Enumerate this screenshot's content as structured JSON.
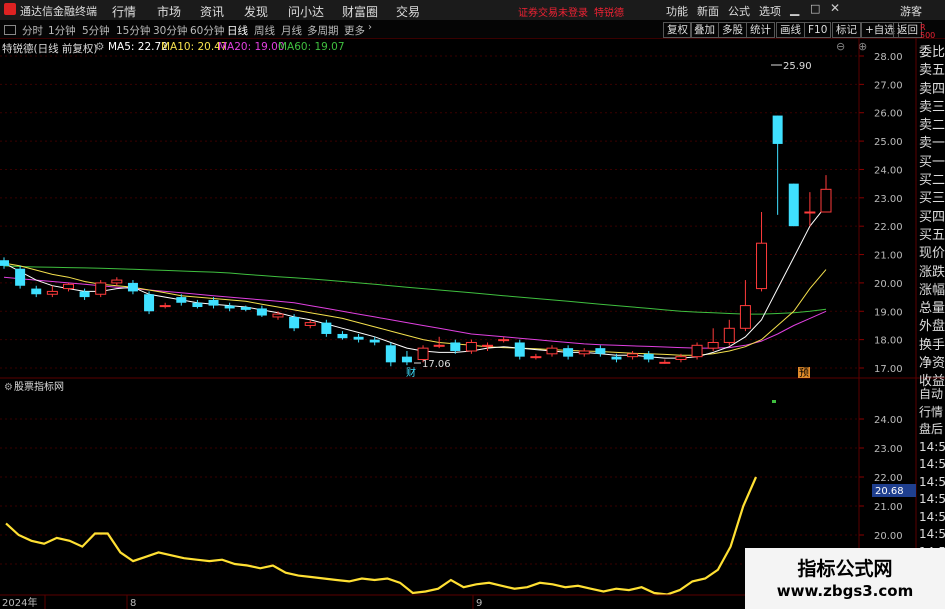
{
  "app": {
    "title": "通达信金融终端",
    "menu": [
      "行情",
      "市场",
      "资讯",
      "发现",
      "问小达",
      "财富圈",
      "交易"
    ],
    "login_warning": "证券交易未登录",
    "stock_tag": "特锐德",
    "right_menu": [
      "功能",
      "新面",
      "公式",
      "选项"
    ],
    "guest": "游客"
  },
  "periods": [
    "分时",
    "1分钟",
    "5分钟",
    "15分钟",
    "30分钟",
    "60分钟",
    "日线",
    "周线",
    "月线",
    "多周期",
    "更多"
  ],
  "active_period": "日线",
  "tools": [
    "复权",
    "叠加",
    "多股",
    "统计",
    "画线",
    "F10",
    "标记",
    "+自选",
    "返回"
  ],
  "chart_header": {
    "stock_name": "特锐德(日线 前复权)",
    "ma": [
      {
        "label": "MA5: 22.72",
        "color": "#ffffff"
      },
      {
        "label": "MA10: 20.47",
        "color": "#f4e04d"
      },
      {
        "label": "MA20: 19.00",
        "color": "#e040e0"
      },
      {
        "label": "MA60: 19.07",
        "color": "#3fbf3f"
      }
    ]
  },
  "indicator_title": "股票指标网",
  "price_axis": [
    "28.00",
    "27.00",
    "26.00",
    "25.00",
    "24.00",
    "23.00",
    "22.00",
    "21.00",
    "20.00",
    "19.00",
    "18.00",
    "17.00"
  ],
  "indicator_axis": [
    "24.00",
    "23.00",
    "22.00",
    "21.00",
    "20.00",
    "19.00"
  ],
  "indicator_value_box": "20.68",
  "annotations": {
    "high": "25.90",
    "low": "17.06",
    "cai": "财",
    "yu": "预"
  },
  "right_labels": [
    "委比",
    "卖五",
    "卖四",
    "卖三",
    "卖二",
    "卖一",
    "买一",
    "买二",
    "买三",
    "买四",
    "买五",
    "现价",
    "涨跌",
    "涨幅",
    "总量",
    "外盘",
    "换手",
    "净资",
    "收益"
  ],
  "right_labels_lower": [
    "自动",
    "行情",
    "盘后",
    "14:50",
    "14:50",
    "14:50",
    "14:50",
    "14:50",
    "14:50",
    "14:50",
    "14:50",
    "14:50"
  ],
  "right_top_small": [
    "R",
    "500"
  ],
  "time_axis": [
    "2024年",
    "8",
    "9"
  ],
  "watermark": {
    "line1": "指标公式网",
    "line2": "www.zbgs3.com"
  },
  "colors": {
    "up": "#ff3b3b",
    "down": "#3fe0ff",
    "indicator": "#ffe033"
  },
  "chart_data": {
    "type": "candlestick",
    "ylim": [
      17.0,
      28.0
    ],
    "candles": [
      [
        20.8,
        20.6,
        20.9,
        20.5
      ],
      [
        20.5,
        19.9,
        20.6,
        19.8
      ],
      [
        19.8,
        19.6,
        19.9,
        19.5
      ],
      [
        19.6,
        19.7,
        19.9,
        19.5
      ],
      [
        19.8,
        19.95,
        20.0,
        19.7
      ],
      [
        19.7,
        19.5,
        19.8,
        19.4
      ],
      [
        19.6,
        20.0,
        20.1,
        19.5
      ],
      [
        20.0,
        20.1,
        20.2,
        19.9
      ],
      [
        20.0,
        19.7,
        20.1,
        19.6
      ],
      [
        19.6,
        19.0,
        19.7,
        18.9
      ],
      [
        19.2,
        19.2,
        19.3,
        19.1
      ],
      [
        19.5,
        19.3,
        19.6,
        19.2
      ],
      [
        19.3,
        19.15,
        19.4,
        19.1
      ],
      [
        19.4,
        19.2,
        19.5,
        19.1
      ],
      [
        19.2,
        19.1,
        19.3,
        19.0
      ],
      [
        19.15,
        19.05,
        19.2,
        19.0
      ],
      [
        19.1,
        18.85,
        19.2,
        18.8
      ],
      [
        18.8,
        18.9,
        19.0,
        18.7
      ],
      [
        18.8,
        18.4,
        18.9,
        18.3
      ],
      [
        18.5,
        18.6,
        18.7,
        18.4
      ],
      [
        18.6,
        18.2,
        18.7,
        18.1
      ],
      [
        18.2,
        18.05,
        18.3,
        18.0
      ],
      [
        18.1,
        18.0,
        18.2,
        17.9
      ],
      [
        18.0,
        17.9,
        18.1,
        17.8
      ],
      [
        17.8,
        17.2,
        17.9,
        17.06
      ],
      [
        17.4,
        17.2,
        17.6,
        17.1
      ],
      [
        17.3,
        17.7,
        17.8,
        17.2
      ],
      [
        17.8,
        17.8,
        18.1,
        17.7
      ],
      [
        17.9,
        17.6,
        18.0,
        17.5
      ],
      [
        17.6,
        17.9,
        18.0,
        17.5
      ],
      [
        17.8,
        17.8,
        17.9,
        17.6
      ],
      [
        18.0,
        18.0,
        18.1,
        17.9
      ],
      [
        17.9,
        17.4,
        18.0,
        17.3
      ],
      [
        17.4,
        17.4,
        17.5,
        17.3
      ],
      [
        17.5,
        17.7,
        17.8,
        17.4
      ],
      [
        17.7,
        17.4,
        17.8,
        17.3
      ],
      [
        17.5,
        17.6,
        17.7,
        17.4
      ],
      [
        17.7,
        17.5,
        17.8,
        17.4
      ],
      [
        17.4,
        17.3,
        17.5,
        17.2
      ],
      [
        17.4,
        17.5,
        17.6,
        17.3
      ],
      [
        17.5,
        17.3,
        17.6,
        17.2
      ],
      [
        17.2,
        17.2,
        17.3,
        17.15
      ],
      [
        17.3,
        17.4,
        17.5,
        17.2
      ],
      [
        17.4,
        17.8,
        17.9,
        17.3
      ],
      [
        17.7,
        17.9,
        18.4,
        17.6
      ],
      [
        17.9,
        18.4,
        18.7,
        17.8
      ],
      [
        18.4,
        19.2,
        20.1,
        18.3
      ],
      [
        19.8,
        21.4,
        22.5,
        19.7
      ],
      [
        25.9,
        24.9,
        25.9,
        22.4
      ],
      [
        23.5,
        22.0,
        23.5,
        22.0
      ],
      [
        22.5,
        22.5,
        23.2,
        22.0
      ],
      [
        22.5,
        23.3,
        23.8,
        22.5
      ]
    ],
    "ma5": [
      20.7,
      20.4,
      20.1,
      19.9,
      19.8,
      19.7,
      19.7,
      19.8,
      19.85,
      19.6,
      19.5,
      19.4,
      19.3,
      19.25,
      19.2,
      19.15,
      19.05,
      18.95,
      18.8,
      18.7,
      18.55,
      18.4,
      18.25,
      18.1,
      17.9,
      17.7,
      17.6,
      17.55,
      17.55,
      17.6,
      17.7,
      17.75,
      17.7,
      17.65,
      17.6,
      17.55,
      17.55,
      17.5,
      17.45,
      17.45,
      17.4,
      17.35,
      17.35,
      17.4,
      17.55,
      17.75,
      18.1,
      18.7,
      19.8,
      20.9,
      22.0,
      22.72
    ],
    "ma10": [
      20.7,
      20.6,
      20.45,
      20.3,
      20.2,
      20.05,
      19.95,
      19.9,
      19.85,
      19.75,
      19.65,
      19.55,
      19.5,
      19.45,
      19.4,
      19.35,
      19.25,
      19.15,
      19.05,
      18.95,
      18.85,
      18.75,
      18.6,
      18.45,
      18.3,
      18.15,
      18.0,
      17.9,
      17.85,
      17.8,
      17.75,
      17.72,
      17.7,
      17.68,
      17.65,
      17.62,
      17.6,
      17.58,
      17.55,
      17.52,
      17.5,
      17.48,
      17.45,
      17.45,
      17.5,
      17.6,
      17.75,
      18.0,
      18.5,
      19.0,
      19.8,
      20.47
    ],
    "ma20": [
      20.2,
      20.15,
      20.1,
      20.05,
      20.0,
      19.95,
      19.9,
      19.85,
      19.8,
      19.75,
      19.7,
      19.65,
      19.6,
      19.55,
      19.5,
      19.45,
      19.4,
      19.35,
      19.3,
      19.2,
      19.1,
      19.0,
      18.9,
      18.8,
      18.7,
      18.6,
      18.5,
      18.4,
      18.3,
      18.2,
      18.15,
      18.1,
      18.05,
      18.0,
      17.95,
      17.9,
      17.85,
      17.82,
      17.8,
      17.78,
      17.76,
      17.74,
      17.72,
      17.7,
      17.7,
      17.72,
      17.8,
      17.95,
      18.2,
      18.5,
      18.75,
      19.0
    ],
    "ma60": [
      20.6,
      20.58,
      20.56,
      20.55,
      20.54,
      20.53,
      20.52,
      20.5,
      20.48,
      20.46,
      20.44,
      20.42,
      20.4,
      20.38,
      20.35,
      20.3,
      20.26,
      20.22,
      20.18,
      20.14,
      20.1,
      20.05,
      20.0,
      19.95,
      19.9,
      19.85,
      19.8,
      19.75,
      19.7,
      19.65,
      19.6,
      19.55,
      19.5,
      19.45,
      19.4,
      19.35,
      19.3,
      19.25,
      19.2,
      19.15,
      19.1,
      19.05,
      19.0,
      18.97,
      18.95,
      18.92,
      18.9,
      18.9,
      18.92,
      18.95,
      19.0,
      19.07
    ],
    "indicator_ylim": [
      18.0,
      25.0
    ],
    "indicator": [
      20.4,
      20.0,
      19.8,
      19.7,
      19.9,
      19.8,
      19.6,
      20.05,
      20.05,
      19.4,
      19.1,
      19.25,
      19.4,
      19.3,
      19.2,
      19.15,
      19.1,
      19.15,
      19.0,
      18.95,
      18.85,
      18.95,
      18.7,
      18.6,
      18.55,
      18.5,
      18.45,
      18.4,
      18.5,
      18.45,
      18.5,
      18.35,
      18.0,
      18.05,
      18.15,
      18.45,
      18.2,
      18.3,
      18.35,
      18.25,
      18.15,
      18.2,
      18.35,
      18.3,
      18.2,
      18.25,
      18.15,
      18.05,
      18.15,
      18.1,
      18.2,
      18.0,
      17.95,
      18.1,
      18.4,
      18.5,
      18.8,
      19.6,
      21.0,
      22.0
    ]
  }
}
